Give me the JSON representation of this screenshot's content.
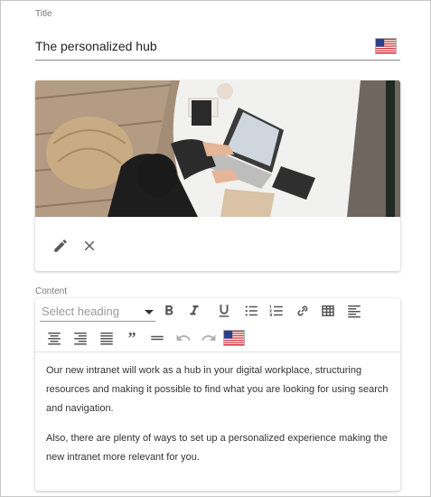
{
  "title_field": {
    "label": "Title",
    "value": "The personalized hub",
    "language_flag": "us-flag-icon"
  },
  "image_card": {
    "image_alt": "person working on laptop at desk",
    "actions": [
      {
        "name": "edit",
        "icon": "pencil-icon"
      },
      {
        "name": "remove",
        "icon": "close-icon"
      }
    ]
  },
  "content_field": {
    "label": "Content",
    "toolbar": {
      "heading_placeholder": "Select heading",
      "buttons": [
        "bold",
        "italic",
        "underline",
        "bulleted-list",
        "numbered-list",
        "link",
        "table",
        "align-left",
        "align-center",
        "align-right",
        "justify",
        "blockquote",
        "horizontal-line",
        "undo",
        "redo"
      ],
      "blockquote_glyph": "”",
      "language_flag": "us-flag-icon"
    },
    "paragraphs": [
      "Our new intranet will work as a hub in your digital workplace, structuring resources and making it possible to find what you are looking for using search and navigation.",
      "Also, there are plenty of ways to set up a personalized experience making the new intranet more relevant for you."
    ]
  }
}
